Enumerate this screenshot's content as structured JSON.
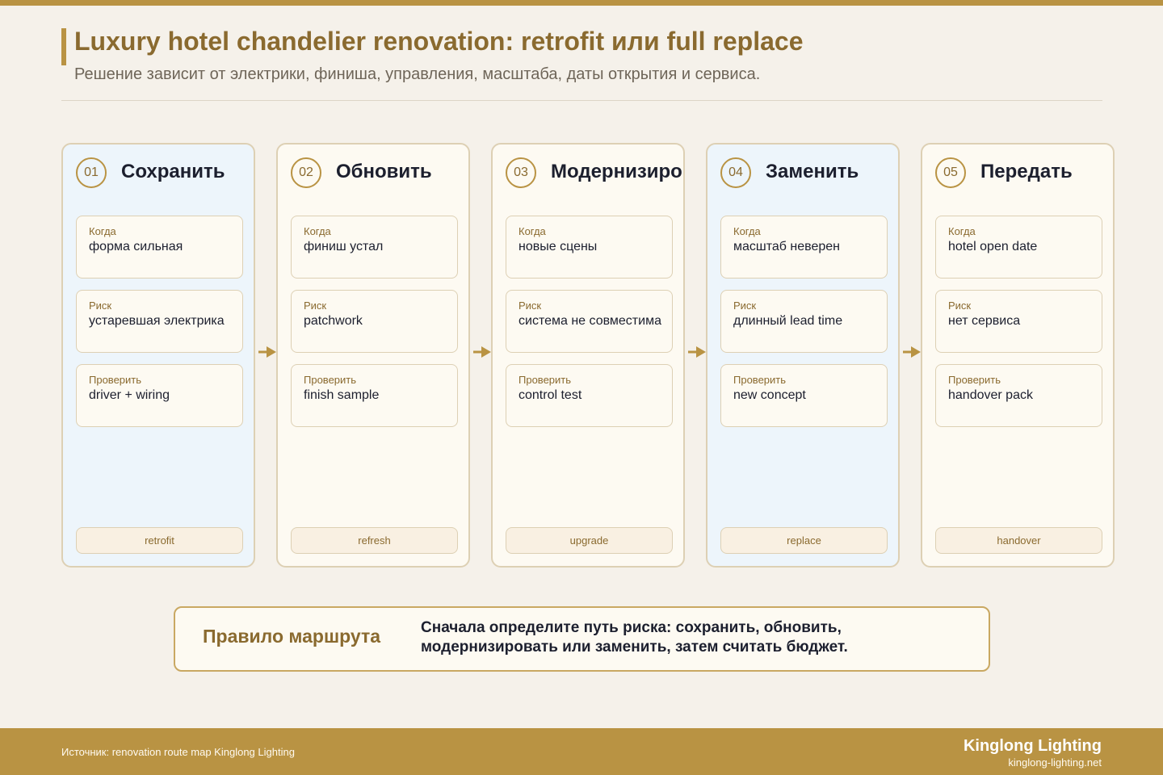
{
  "header": {
    "title": "Luxury hotel chandelier renovation: retrofit или full replace",
    "subtitle": "Решение зависит от электрики, финиша, управления, масштаба, даты открытия и сервиса."
  },
  "stages": [
    {
      "number": "01",
      "title": "Сохранить",
      "fields": [
        {
          "label": "Когда",
          "value": "форма сильная"
        },
        {
          "label": "Риск",
          "value": "устаревшая электрика"
        },
        {
          "label": "Проверить",
          "value": "driver + wiring"
        }
      ],
      "tag": "retrofit"
    },
    {
      "number": "02",
      "title": "Обновить",
      "fields": [
        {
          "label": "Когда",
          "value": "финиш устал"
        },
        {
          "label": "Риск",
          "value": "patchwork"
        },
        {
          "label": "Проверить",
          "value": "finish sample"
        }
      ],
      "tag": "refresh"
    },
    {
      "number": "03",
      "title": "Модернизировать",
      "fields": [
        {
          "label": "Когда",
          "value": "новые сцены"
        },
        {
          "label": "Риск",
          "value": "система не совместима"
        },
        {
          "label": "Проверить",
          "value": "control test"
        }
      ],
      "tag": "upgrade"
    },
    {
      "number": "04",
      "title": "Заменить",
      "fields": [
        {
          "label": "Когда",
          "value": "масштаб неверен"
        },
        {
          "label": "Риск",
          "value": "длинный lead time"
        },
        {
          "label": "Проверить",
          "value": "new concept"
        }
      ],
      "tag": "replace"
    },
    {
      "number": "05",
      "title": "Передать",
      "fields": [
        {
          "label": "Когда",
          "value": "hotel open date"
        },
        {
          "label": "Риск",
          "value": "нет сервиса"
        },
        {
          "label": "Проверить",
          "value": "handover pack"
        }
      ],
      "tag": "handover"
    }
  ],
  "route_rule": {
    "title": "Правило маршрута",
    "text": "Сначала определите путь риска: сохранить, обновить, модернизировать или заменить, затем считать бюджет."
  },
  "footer": {
    "source": "Источник: renovation route map Kinglong Lighting",
    "brand": "Kinglong Lighting",
    "site": "kinglong-lighting.net"
  },
  "colors": {
    "accent": "#b99343",
    "accent_text": "#8a6a2f",
    "background": "#f5f1ea",
    "card_blue": "#edf5fb",
    "card_cream": "#fdfaf2"
  },
  "icons": {
    "arrow": "arrow-right-icon"
  }
}
